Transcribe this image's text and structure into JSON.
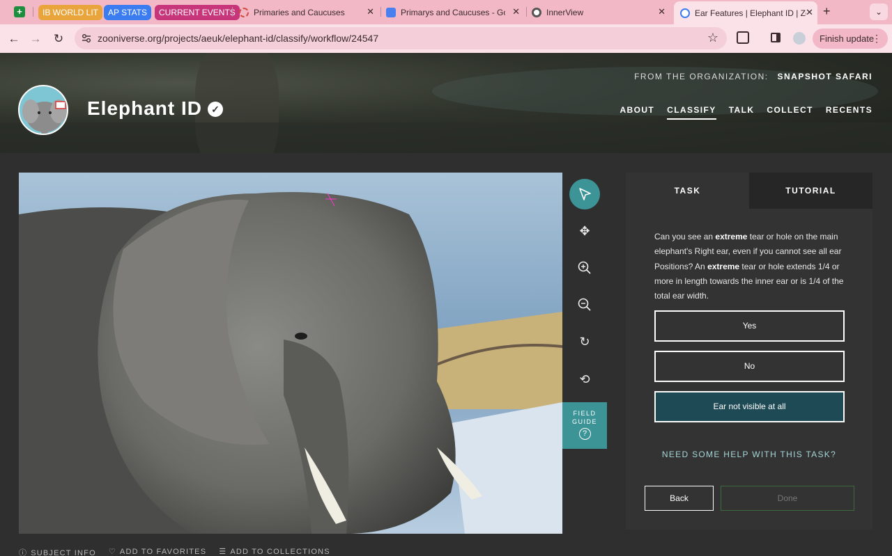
{
  "browser": {
    "tab_groups": [
      {
        "label": "IB WORLD LIT",
        "color": "#e9a53b"
      },
      {
        "label": "AP STATS",
        "color": "#3b7df0"
      },
      {
        "label": "CURRENT EVENTS",
        "color": "#c7367a"
      }
    ],
    "tabs": [
      {
        "title": "Primaries and Caucuses",
        "icon": "primaries-icon"
      },
      {
        "title": "Primarys and Caucuses - Goo",
        "icon": "google-docs-icon"
      },
      {
        "title": "InnerView",
        "icon": "innerview-icon"
      },
      {
        "title": "Ear Features | Elephant ID | Zo",
        "icon": "zooniverse-icon",
        "active": true
      }
    ],
    "new_tab_glyph": "+",
    "url": "zooniverse.org/projects/aeuk/elephant-id/classify/workflow/24547",
    "finish_update_label": "Finish update"
  },
  "header": {
    "org_prefix": "FROM THE ORGANIZATION:",
    "org_name": "SNAPSHOT SAFARI",
    "project_title": "Elephant ID",
    "nav": [
      "ABOUT",
      "CLASSIFY",
      "TALK",
      "COLLECT",
      "RECENTS"
    ],
    "active_nav": "CLASSIFY"
  },
  "viewer": {
    "tools": [
      "pointer-icon",
      "pan-icon",
      "zoom-in-icon",
      "zoom-out-icon",
      "rotate-icon",
      "reset-icon"
    ],
    "field_guide_label": "FIELD\nGUIDE",
    "field_guide_icon": "?"
  },
  "subject_meta": {
    "info": "SUBJECT INFO",
    "favorites": "ADD TO FAVORITES",
    "collections": "ADD TO COLLECTIONS"
  },
  "task": {
    "tab_task": "TASK",
    "tab_tutorial": "TUTORIAL",
    "question_parts": [
      {
        "text": "Can you see an ",
        "bold": false
      },
      {
        "text": "extreme",
        "bold": true
      },
      {
        "text": " tear or hole on the main elephant's Right ear, even if you cannot see all ear Positions? An ",
        "bold": false
      },
      {
        "text": "extreme",
        "bold": true
      },
      {
        "text": " tear or hole extends 1/4 or more in length towards the inner ear or is 1/4 of the total ear width.",
        "bold": false
      }
    ],
    "answers": [
      "Yes",
      "No",
      "Ear not visible at all"
    ],
    "selected_answer": "Ear not visible at all",
    "help_link": "NEED SOME HELP WITH THIS TASK?",
    "back_label": "Back",
    "done_label": "Done"
  }
}
